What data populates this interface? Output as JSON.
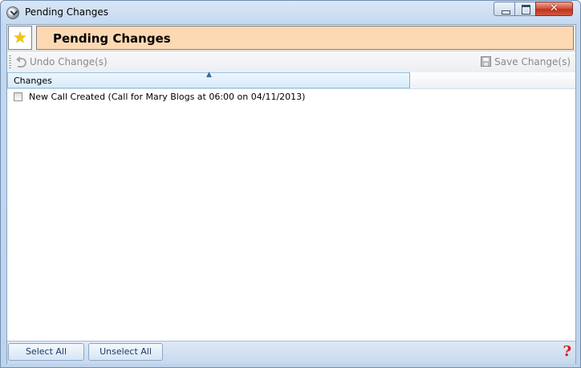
{
  "window": {
    "title": "Pending Changes",
    "controls": {
      "minimize": "minimize",
      "maximize": "maximize",
      "close": "✕"
    }
  },
  "header": {
    "title": "Pending Changes",
    "star_icon": "star-icon",
    "star_color": "#f2c600",
    "band_color": "#fdd9b3"
  },
  "toolbar": {
    "undo_label": "Undo Change(s)",
    "save_label": "Save Change(s)",
    "undo_icon": "undo-icon",
    "save_icon": "save-icon"
  },
  "grid": {
    "columns": [
      {
        "label": "Changes",
        "sorted": "ascending"
      }
    ],
    "rows": [
      {
        "checked": false,
        "text": "New Call Created (Call for Mary Blogs at 06:00 on 04/11/2013)"
      }
    ]
  },
  "footer": {
    "select_all_label": "Select All",
    "unselect_all_label": "Unselect All",
    "help_glyph": "?",
    "help_color": "#d11a12"
  }
}
